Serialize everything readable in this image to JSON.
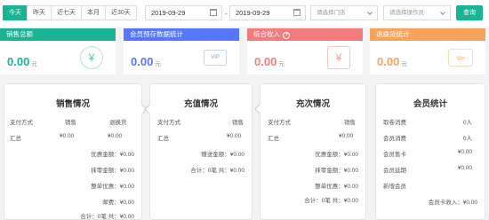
{
  "filter": {
    "tabs": [
      "今天",
      "昨天",
      "近七天",
      "本月",
      "近30天"
    ],
    "active_tab": "今天",
    "start_date": "2019-09-29",
    "date_separator": "-",
    "end_date": "2019-09-29",
    "store_placeholder": "请选择门店",
    "operator_placeholder": "请选择操作员",
    "query_label": "查询"
  },
  "cards": [
    {
      "title": "销售总额",
      "value": "0.00",
      "unit": "元",
      "icon": "yen-circle-icon",
      "icon_glyph": "¥"
    },
    {
      "title": "会员预存数据统计",
      "value": "0.00",
      "unit": "元",
      "icon": "vip-card-icon",
      "icon_glyph": "VIP"
    },
    {
      "title": "综合收入",
      "value": "0.00",
      "unit": "元",
      "icon": "yen-bag-icon",
      "icon_glyph": "¥",
      "info": "?"
    },
    {
      "title": "退换货统计",
      "value": "0.00",
      "unit": "元",
      "icon": "wallet-return-icon",
      "icon_glyph": "⇦"
    }
  ],
  "sales": {
    "title": "销售情况",
    "col_method": "支付方式",
    "col_sale": "销售",
    "col_return": "退换货",
    "total_label": "汇总",
    "total_sale": "¥0.00",
    "total_return": "¥0.00",
    "lines": [
      {
        "label": "优惠金额：",
        "value": "¥0.00"
      },
      {
        "label": "抹零金额：",
        "value": "¥0.00"
      },
      {
        "label": "整单优惠：",
        "value": "¥0.00"
      },
      {
        "label": "邮费：",
        "value": "¥0.00"
      },
      {
        "label": "合计：0笔 共：",
        "value": "¥0.00"
      }
    ]
  },
  "recharge": {
    "title": "充值情况",
    "col_method": "支付方式",
    "col_sale": "销售",
    "total_label": "汇总",
    "total_value": "¥0.00",
    "gift_label": "赠送金额：",
    "gift_value": "¥0.00",
    "sum_label": "合计：0笔 共：",
    "sum_value": "¥0.00"
  },
  "times": {
    "title": "充次情况",
    "col_method": "支付方式",
    "col_sale": "销售",
    "total_label": "汇总",
    "total_value": "¥0.00",
    "lines": [
      {
        "label": "优惠金额：",
        "value": "¥0.00"
      },
      {
        "label": "抹零金额：",
        "value": "¥0.00"
      },
      {
        "label": "整单优惠：",
        "value": "¥0.00"
      },
      {
        "label": "合计：0笔 共：",
        "value": "¥0.00"
      }
    ]
  },
  "member": {
    "title": "会员统计",
    "rows": [
      {
        "label": "取卷消费",
        "value": "0人"
      },
      {
        "label": "会员消费",
        "value": "0人"
      },
      {
        "label": "会员售卡",
        "value": "¥0.00"
      },
      {
        "label": "会员延期",
        "value": "¥0.00"
      },
      {
        "label": "新增会员",
        "value": ""
      }
    ],
    "income_label": "会员卡收入：",
    "income_value": "¥0.00"
  }
}
